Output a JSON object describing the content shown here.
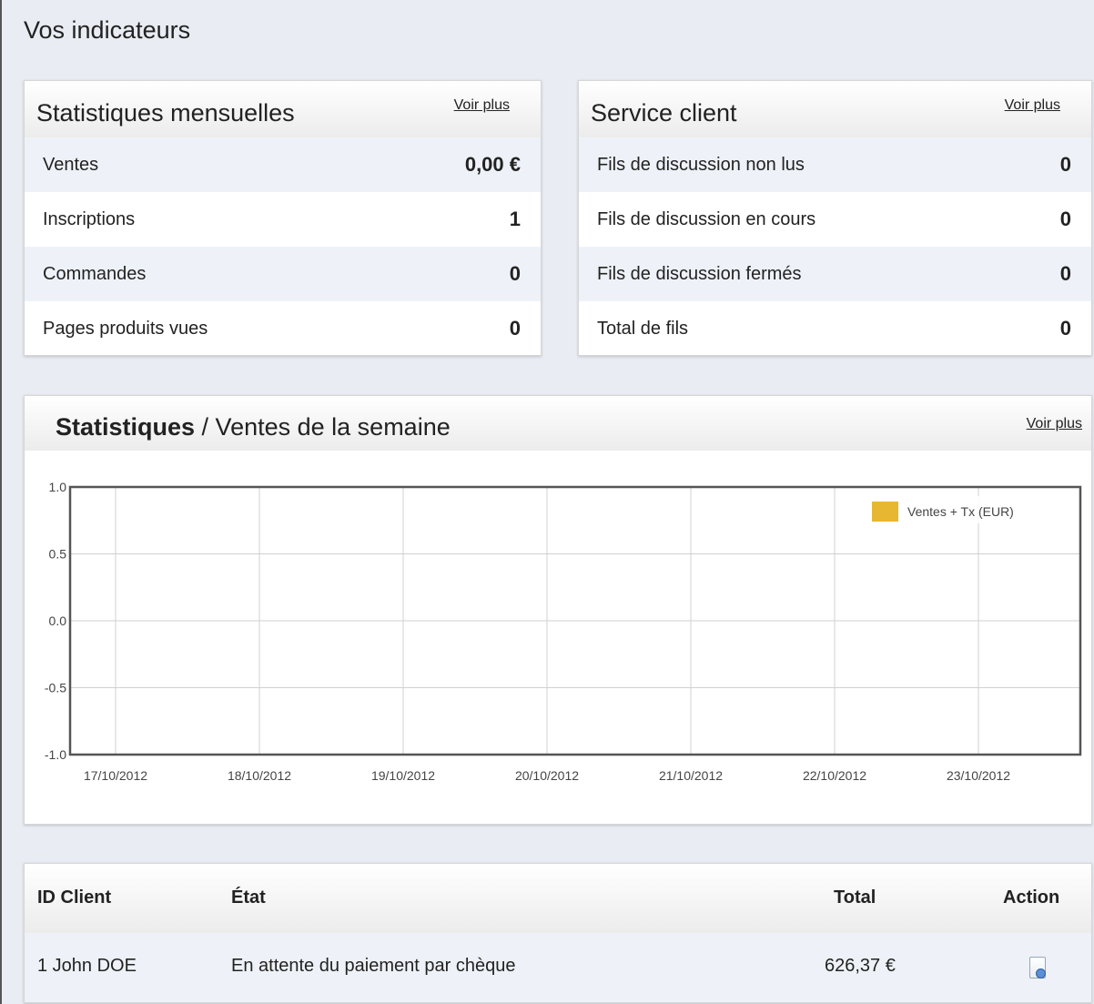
{
  "page": {
    "title": "Vos indicateurs"
  },
  "monthly": {
    "title": "Statistiques mensuelles",
    "more": "Voir plus",
    "rows": [
      {
        "label": "Ventes",
        "value": "0,00 €"
      },
      {
        "label": "Inscriptions",
        "value": "1"
      },
      {
        "label": "Commandes",
        "value": "0"
      },
      {
        "label": "Pages produits vues",
        "value": "0"
      }
    ]
  },
  "service": {
    "title": "Service client",
    "more": "Voir plus",
    "rows": [
      {
        "label": "Fils de discussion non lus",
        "value": "0"
      },
      {
        "label": "Fils de discussion en cours",
        "value": "0"
      },
      {
        "label": "Fils de discussion fermés",
        "value": "0"
      },
      {
        "label": "Total de fils",
        "value": "0"
      }
    ]
  },
  "weekly": {
    "title_bold": "Statistiques",
    "title_rest": " / Ventes de la semaine",
    "more": "Voir plus"
  },
  "chart_data": {
    "type": "line",
    "categories": [
      "17/10/2012",
      "18/10/2012",
      "19/10/2012",
      "20/10/2012",
      "21/10/2012",
      "22/10/2012",
      "23/10/2012"
    ],
    "series": [
      {
        "name": "Ventes + Tx (EUR)",
        "values": [],
        "color": "#e8b731"
      }
    ],
    "yticks": [
      "1.0",
      "0.5",
      "0.0",
      "-0.5",
      "-1.0"
    ],
    "ylim": [
      -1,
      1
    ],
    "grid": true,
    "legend": "top-right"
  },
  "orders": {
    "headers": {
      "client": "ID Client",
      "state": "État",
      "total": "Total",
      "action": "Action"
    },
    "rows": [
      {
        "client": "1 John DOE",
        "state": "En attente du paiement par chèque",
        "total": "626,37 €",
        "action_icon": "view-document-icon"
      }
    ]
  }
}
